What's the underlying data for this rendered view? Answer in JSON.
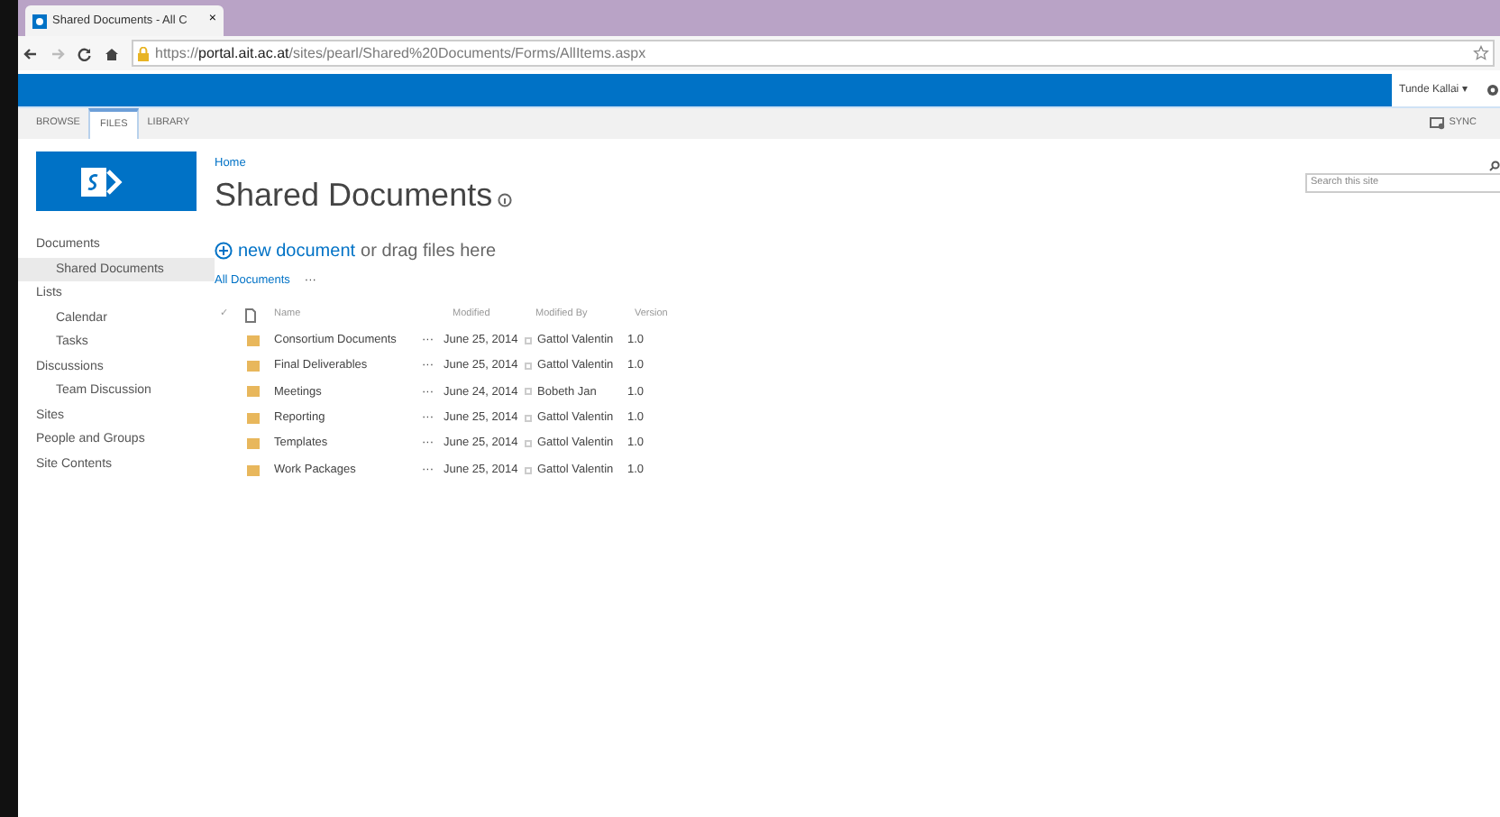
{
  "browser": {
    "tab_title": "Shared Documents - All C",
    "tab_close": "×",
    "url": "https://**portal.ait.ac.at**/sites/pearl/Shared%20Documents/Forms/AllItems.aspx"
  },
  "suite_bar": {
    "user": "Tunde Kallai ▾"
  },
  "ribbon": {
    "tabs": [
      {
        "label": "BROWSE",
        "selected": false
      },
      {
        "label": "FILES",
        "selected": true
      },
      {
        "label": "LIBRARY",
        "selected": false
      }
    ],
    "sync": "SYNC"
  },
  "search": {
    "placeholder": "Search this site"
  },
  "nav": [
    {
      "label": "Documents",
      "selected": false,
      "children": [
        {
          "label": "Shared Documents",
          "selected": true
        }
      ]
    },
    {
      "label": "Lists",
      "selected": false,
      "children": [
        {
          "label": "Calendar",
          "selected": false
        },
        {
          "label": "Tasks",
          "selected": false
        }
      ]
    },
    {
      "label": "Discussions",
      "selected": false,
      "children": [
        {
          "label": "Team Discussion",
          "selected": false
        }
      ]
    },
    {
      "label": "Sites",
      "selected": false
    },
    {
      "label": "People and Groups",
      "selected": false
    },
    {
      "label": "Site Contents",
      "selected": false
    }
  ],
  "breadcrumb": "Home",
  "page_title": "Shared Documents",
  "new_document": {
    "link": "new document",
    "rest": "or drag files here"
  },
  "view": {
    "label": "All Documents",
    "more": "···"
  },
  "table": {
    "check": "✓",
    "columns": [
      "Name",
      "Modified",
      "Modified By",
      "Version"
    ],
    "rows": [
      {
        "name": "Consortium Documents",
        "more": "···",
        "modified": "June 25, 2014",
        "modified_by": "Gattol Valentin",
        "version": "1.0"
      },
      {
        "name": "Final Deliverables",
        "more": "···",
        "modified": "June 25, 2014",
        "modified_by": "Gattol Valentin",
        "version": "1.0"
      },
      {
        "name": "Meetings",
        "more": "···",
        "modified": "June 24, 2014",
        "modified_by": "Bobeth Jan",
        "version": "1.0"
      },
      {
        "name": "Reporting",
        "more": "···",
        "modified": "June 25, 2014",
        "modified_by": "Gattol Valentin",
        "version": "1.0"
      },
      {
        "name": "Templates",
        "more": "···",
        "modified": "June 25, 2014",
        "modified_by": "Gattol Valentin",
        "version": "1.0"
      },
      {
        "name": "Work Packages",
        "more": "···",
        "modified": "June 25, 2014",
        "modified_by": "Gattol Valentin",
        "version": "1.0"
      }
    ]
  }
}
